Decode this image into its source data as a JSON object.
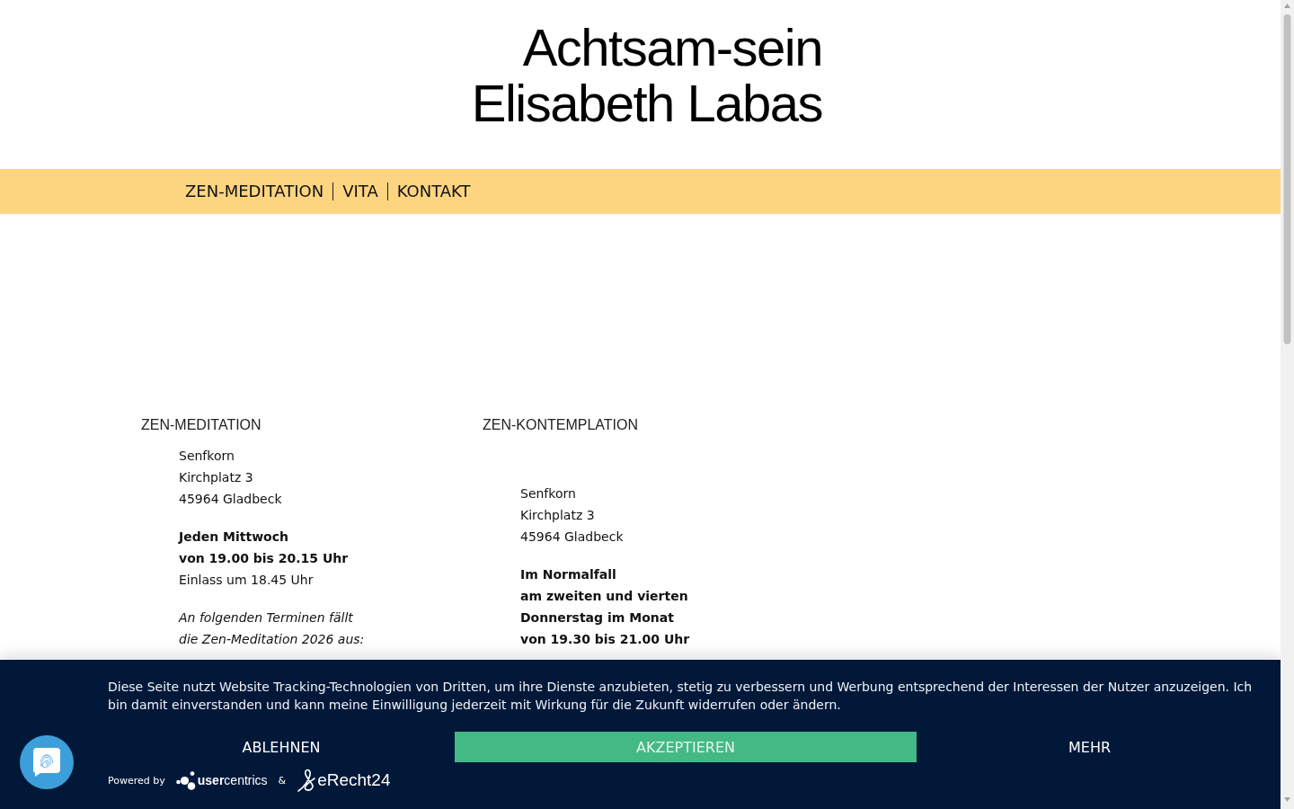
{
  "logo": {
    "lines": [
      "Achtsam-sein",
      "Elisabeth Labas"
    ]
  },
  "nav": {
    "items": [
      {
        "label": "ZEN-MEDITATION"
      },
      {
        "label": "VITA"
      },
      {
        "label": "KONTAKT"
      }
    ]
  },
  "columns": [
    {
      "heading": "ZEN-MEDITATION",
      "paragraphs": [
        {
          "kind": "address",
          "lines": [
            {
              "text": "Senfkorn",
              "bold": false
            },
            {
              "text": "Kirchplatz 3",
              "bold": false
            },
            {
              "text": "45964 Gladbeck",
              "bold": false
            }
          ]
        },
        {
          "kind": "schedule",
          "lines": [
            {
              "text": "Jeden Mittwoch",
              "bold": true
            },
            {
              "text": "von 19.00 bis 20.15 Uhr",
              "bold": true
            },
            {
              "text": "Einlass um 18.45 Uhr",
              "bold": false
            }
          ]
        },
        {
          "kind": "note",
          "lines": [
            {
              "text": "An folgenden Terminen fällt",
              "bold": false
            },
            {
              "text": "die Zen-Meditation 2026 aus:",
              "bold": false
            }
          ]
        }
      ]
    },
    {
      "heading": "ZEN-KONTEMPLATION",
      "paragraphs": [
        {
          "kind": "address",
          "lines": [
            {
              "text": "Senfkorn",
              "bold": false
            },
            {
              "text": "Kirchplatz 3",
              "bold": false
            },
            {
              "text": "45964 Gladbeck",
              "bold": false
            }
          ]
        },
        {
          "kind": "schedule",
          "lines": [
            {
              "text": "Im Normalfall",
              "bold": true
            },
            {
              "text": "am zweiten und vierten",
              "bold": true
            },
            {
              "text": "Donnerstag im Monat",
              "bold": true
            },
            {
              "text": "von 19.30 bis 21.00 Uhr",
              "bold": true
            }
          ]
        }
      ]
    }
  ],
  "cookie_banner": {
    "text": "Diese Seite nutzt Website Tracking-Technologien von Dritten, um ihre Dienste anzubieten, stetig zu verbessern und Werbung entsprechend der Interessen der Nutzer anzuzeigen. Ich bin damit einverstanden und kann meine Einwilligung jederzeit mit Wirkung für die Zukunft widerrufen oder ändern.",
    "buttons": [
      {
        "label": "ABLEHNEN",
        "kind": "plain"
      },
      {
        "label": "AKZEPTIEREN",
        "kind": "primary"
      },
      {
        "label": "MEHR",
        "kind": "plain"
      }
    ],
    "powered_by": "Powered by",
    "separator": "&",
    "partners": [
      {
        "kind": "dots",
        "name": "**user**centrics"
      },
      {
        "kind": "swirl",
        "name": "eRecht24"
      }
    ]
  }
}
